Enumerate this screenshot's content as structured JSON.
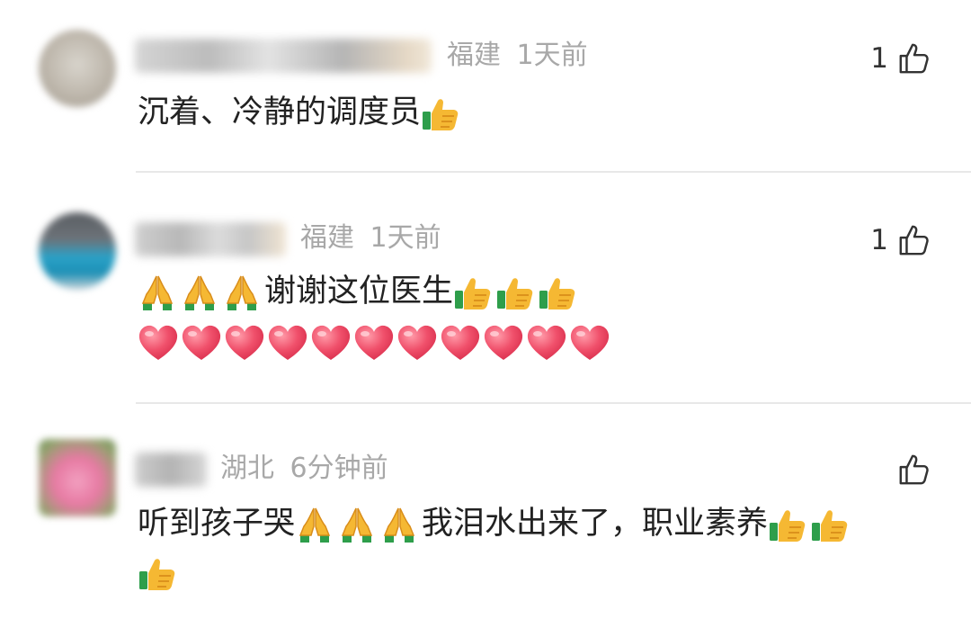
{
  "comments": [
    {
      "location": "福建",
      "time": "1天前",
      "likes": "1",
      "text": "沉着、冷静的调度员",
      "trailing_emoji": [
        "thumbs-up"
      ]
    },
    {
      "location": "福建",
      "time": "1天前",
      "likes": "1",
      "leading_emoji": [
        "folded-hands",
        "folded-hands",
        "folded-hands"
      ],
      "text": "谢谢这位医生",
      "trailing_emoji": [
        "thumbs-up",
        "thumbs-up",
        "thumbs-up"
      ],
      "second_line_emoji": [
        "red-heart",
        "red-heart",
        "red-heart",
        "red-heart",
        "red-heart",
        "red-heart",
        "red-heart",
        "red-heart",
        "red-heart",
        "red-heart",
        "red-heart"
      ]
    },
    {
      "location": "湖北",
      "time": "6分钟前",
      "likes": "",
      "text_part1": "听到孩子哭",
      "mid_emoji": [
        "folded-hands",
        "folded-hands",
        "folded-hands"
      ],
      "text_part2": "我泪水出来了，职业素养",
      "trailing_emoji": [
        "thumbs-up",
        "thumbs-up"
      ],
      "second_line_emoji": [
        "thumbs-up"
      ]
    }
  ],
  "icons": {
    "like": "thumbs-up-outline-icon"
  },
  "colors": {
    "meta_text": "#a8a8a8",
    "divider": "#e8e8e8",
    "body_text": "#222222"
  }
}
